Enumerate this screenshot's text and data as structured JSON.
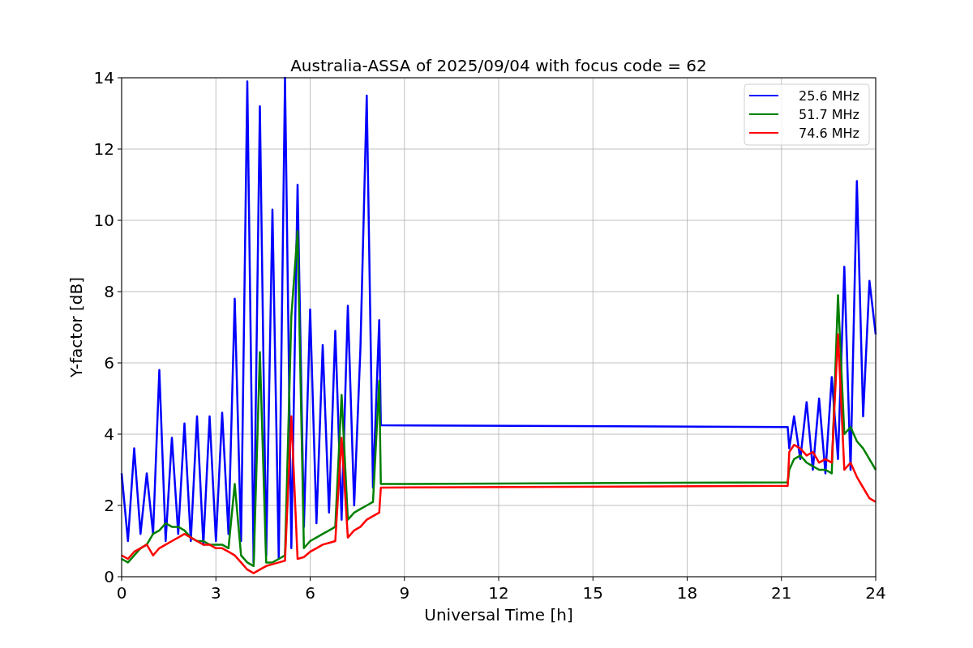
{
  "chart_data": {
    "type": "line",
    "title": "Australia-ASSA of 2025/09/04 with focus code = 62",
    "xlabel": "Universal Time [h]",
    "ylabel": "Y-factor [dB]",
    "xlim": [
      0,
      24
    ],
    "ylim": [
      0,
      14
    ],
    "xticks": [
      0,
      3,
      6,
      9,
      12,
      15,
      18,
      21,
      24
    ],
    "yticks": [
      0,
      2,
      4,
      6,
      8,
      10,
      12,
      14
    ],
    "grid": true,
    "legend": true,
    "x": [
      0,
      0.2,
      0.4,
      0.6,
      0.8,
      1.0,
      1.2,
      1.4,
      1.6,
      1.8,
      2.0,
      2.2,
      2.4,
      2.6,
      2.8,
      3.0,
      3.2,
      3.4,
      3.6,
      3.8,
      4.0,
      4.2,
      4.4,
      4.6,
      4.8,
      5.0,
      5.2,
      5.4,
      5.6,
      5.8,
      6.0,
      6.2,
      6.4,
      6.6,
      6.8,
      7.0,
      7.2,
      7.4,
      7.6,
      7.8,
      8.0,
      8.2,
      8.25,
      21.2,
      21.25,
      21.4,
      21.6,
      21.8,
      22.0,
      22.2,
      22.4,
      22.6,
      22.8,
      23.0,
      23.2,
      23.4,
      23.6,
      23.8,
      24.0
    ],
    "series": [
      {
        "name": "25.6 MHz",
        "color": "#0000ff",
        "values": [
          2.9,
          1.0,
          3.6,
          1.2,
          2.9,
          1.2,
          5.8,
          1.0,
          3.9,
          1.2,
          4.3,
          1.0,
          4.5,
          0.9,
          4.5,
          1.0,
          4.6,
          1.2,
          7.8,
          1.0,
          13.9,
          0.4,
          13.2,
          0.6,
          10.3,
          0.5,
          14.0,
          0.8,
          11.0,
          1.4,
          7.5,
          1.5,
          6.5,
          1.8,
          6.9,
          1.6,
          7.6,
          2.0,
          6.4,
          13.5,
          2.5,
          7.2,
          4.25,
          4.2,
          3.6,
          4.5,
          3.3,
          4.9,
          3.0,
          5.0,
          2.9,
          5.6,
          3.3,
          8.7,
          3.0,
          11.1,
          4.5,
          8.3,
          6.8
        ]
      },
      {
        "name": "51.7 MHz",
        "color": "#008000",
        "values": [
          0.5,
          0.4,
          0.6,
          0.8,
          0.9,
          1.2,
          1.3,
          1.5,
          1.4,
          1.4,
          1.3,
          1.1,
          1.0,
          1.0,
          0.9,
          0.9,
          0.9,
          0.8,
          2.6,
          0.6,
          0.4,
          0.3,
          6.3,
          0.4,
          0.4,
          0.5,
          0.6,
          7.3,
          9.7,
          0.8,
          1.0,
          1.1,
          1.2,
          1.3,
          1.4,
          5.1,
          1.6,
          1.8,
          1.9,
          2.0,
          2.1,
          5.5,
          2.6,
          2.65,
          3.0,
          3.3,
          3.4,
          3.2,
          3.1,
          3.0,
          3.0,
          2.9,
          7.9,
          4.0,
          4.2,
          3.8,
          3.6,
          3.3,
          3.0
        ]
      },
      {
        "name": "74.6 MHz",
        "color": "#ff0000",
        "values": [
          0.6,
          0.5,
          0.7,
          0.8,
          0.9,
          0.6,
          0.8,
          0.9,
          1.0,
          1.1,
          1.2,
          1.1,
          1.0,
          0.9,
          0.9,
          0.8,
          0.8,
          0.7,
          0.6,
          0.4,
          0.2,
          0.1,
          0.2,
          0.3,
          0.35,
          0.4,
          0.45,
          4.5,
          0.5,
          0.55,
          0.7,
          0.8,
          0.9,
          0.95,
          1.0,
          3.9,
          1.1,
          1.3,
          1.4,
          1.6,
          1.7,
          1.8,
          2.5,
          2.55,
          3.5,
          3.7,
          3.6,
          3.4,
          3.5,
          3.2,
          3.3,
          3.2,
          6.8,
          3.0,
          3.2,
          2.8,
          2.5,
          2.2,
          2.1
        ]
      }
    ]
  }
}
